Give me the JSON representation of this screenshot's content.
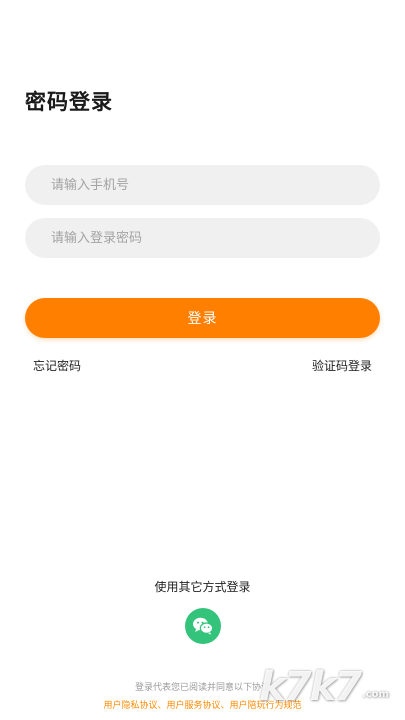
{
  "header": {
    "title": "密码登录"
  },
  "form": {
    "phone_placeholder": "请输入手机号",
    "password_placeholder": "请输入登录密码",
    "submit_label": "登录"
  },
  "links": {
    "forgot_password": "忘记密码",
    "sms_login": "验证码登录"
  },
  "other_login": {
    "title": "使用其它方式登录",
    "wechat_icon": "wechat-icon",
    "wechat_color": "#33c37a"
  },
  "agreement": {
    "notice": "登录代表您已阅读并同意以下协议",
    "links": "用户隐私协议、用户服务协议、用户陪玩行为规范"
  },
  "watermark": {
    "text": "k7k7",
    "suffix": ".com"
  },
  "colors": {
    "accent": "#ff7f00",
    "field_bg": "#f0f0f0"
  }
}
